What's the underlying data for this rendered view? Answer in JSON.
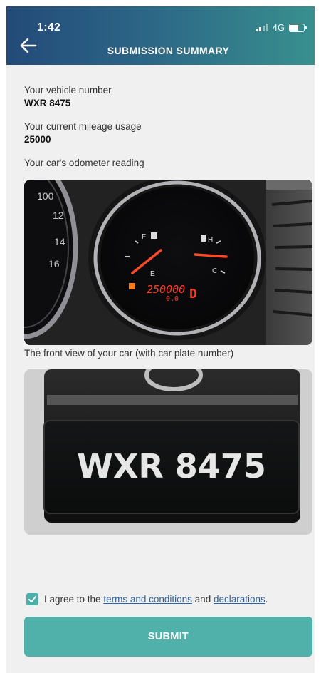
{
  "status_bar": {
    "time": "1:42",
    "network": "4G"
  },
  "header": {
    "title": "SUBMISSION SUMMARY"
  },
  "summary": {
    "vehicle_label": "Your vehicle number",
    "vehicle_value": "WXR 8475",
    "mileage_label": "Your current mileage usage",
    "mileage_value": "25000",
    "odometer_label": "Your car's odometer reading",
    "front_view_label": "The front view of your car (with car plate number)"
  },
  "odometer_photo": {
    "speedo_numbers": [
      "100",
      "12",
      "14",
      "16"
    ],
    "fuel_labels": [
      "F",
      "E"
    ],
    "temp_labels": [
      "H",
      "C"
    ],
    "odometer_reading": "250000",
    "trip_reading": "0.0",
    "gear_indicator": "D"
  },
  "plate_photo": {
    "plate_text": "WXR 8475"
  },
  "agreement": {
    "prefix": "I agree to the",
    "terms_link": "terms and conditions",
    "middle": "and",
    "declarations_link": "declarations",
    "suffix": ".",
    "checked": true
  },
  "submit": {
    "label": "SUBMIT"
  },
  "colors": {
    "accent": "#4fb1aa",
    "header_start": "#234a78",
    "header_end": "#38908e",
    "odo_red": "#ff3a1f"
  }
}
